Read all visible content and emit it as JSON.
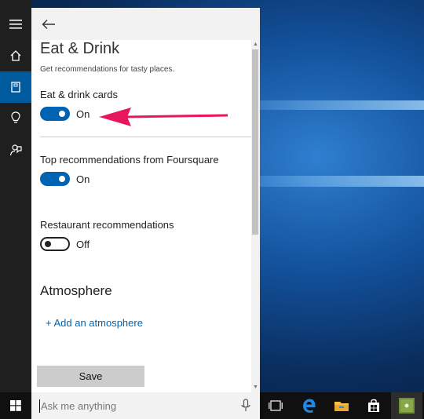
{
  "panel": {
    "title": "Eat & Drink",
    "subtitle": "Get recommendations for tasty places.",
    "settings": [
      {
        "label": "Eat & drink cards",
        "state": "On",
        "enabled": true
      },
      {
        "label": "Top recommendations from Foursquare",
        "state": "On",
        "enabled": true
      },
      {
        "label": "Restaurant recommendations",
        "state": "Off",
        "enabled": false
      }
    ],
    "atmosphere": {
      "heading": "Atmosphere",
      "add_link": "+ Add an atmosphere"
    },
    "save_label": "Save"
  },
  "rail": {
    "items": [
      "hamburger-menu-icon",
      "home-icon",
      "notebook-icon",
      "lightbulb-icon",
      "feedback-icon"
    ],
    "active_index": 2
  },
  "taskbar": {
    "search_placeholder": "Ask me anything",
    "apps": [
      "task-view-icon",
      "edge-icon",
      "file-explorer-icon",
      "store-icon",
      "app-icon"
    ]
  },
  "colors": {
    "accent": "#0063b1",
    "annotation_arrow": "#e8175d",
    "rail_active": "#005a9e"
  }
}
